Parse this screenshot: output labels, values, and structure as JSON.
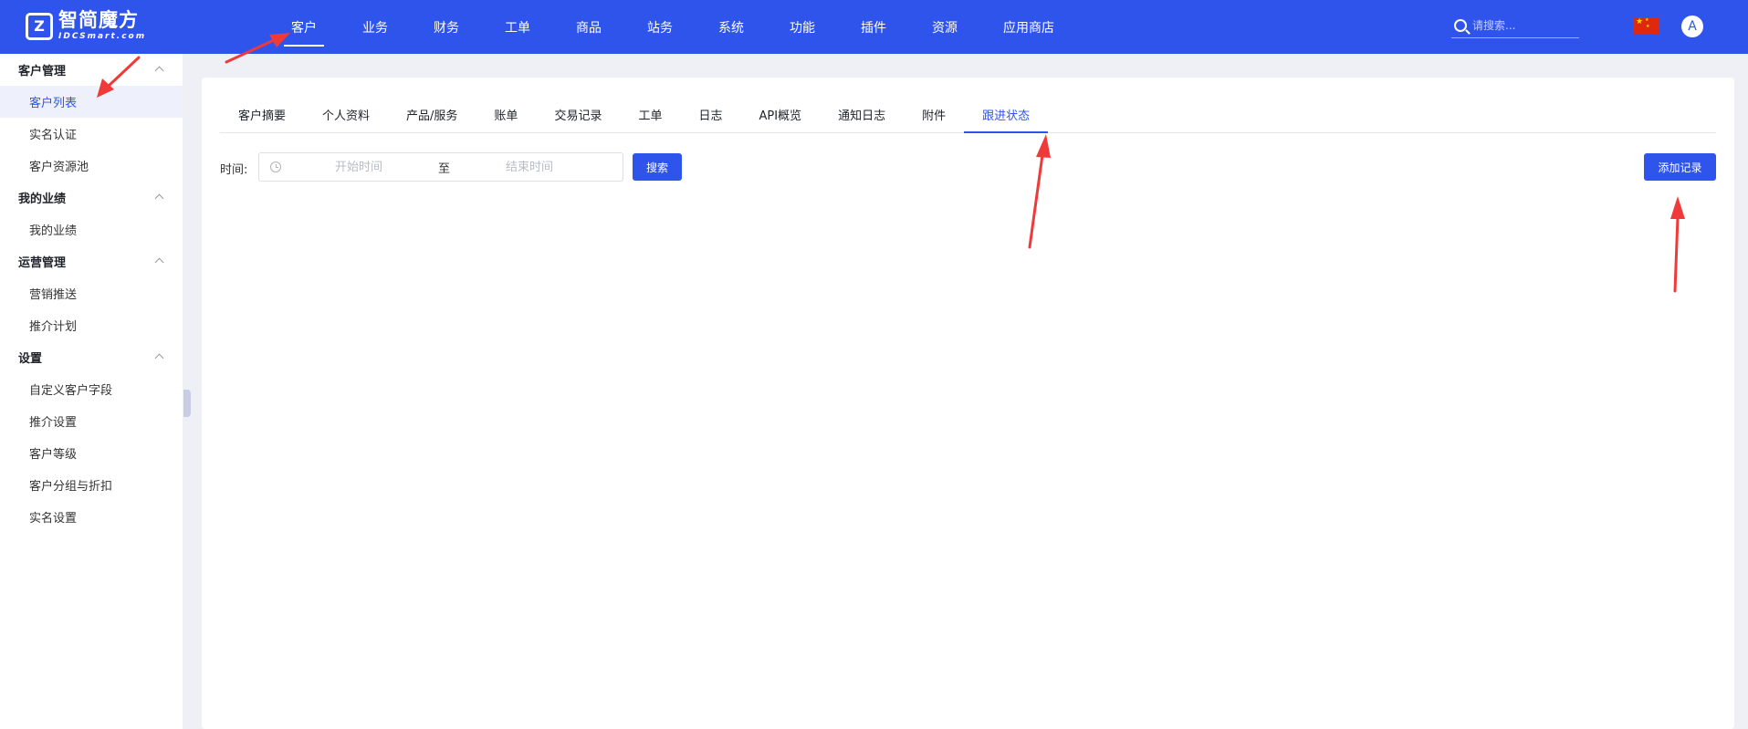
{
  "brand": {
    "logo_mark": "Z",
    "name_cn": "智简魔方",
    "name_en": "IDCSmart.com"
  },
  "topnav": {
    "items": [
      {
        "label": "客户",
        "active": true
      },
      {
        "label": "业务"
      },
      {
        "label": "财务"
      },
      {
        "label": "工单"
      },
      {
        "label": "商品"
      },
      {
        "label": "站务"
      },
      {
        "label": "系统"
      },
      {
        "label": "功能"
      },
      {
        "label": "插件"
      },
      {
        "label": "资源"
      },
      {
        "label": "应用商店"
      }
    ],
    "search_placeholder": "请搜索...",
    "avatar_letter": "A",
    "flag_icon": "china-flag-icon"
  },
  "sidebar": {
    "groups": [
      {
        "title": "客户管理",
        "items": [
          {
            "label": "客户列表",
            "active": true
          },
          {
            "label": "实名认证"
          },
          {
            "label": "客户资源池"
          }
        ]
      },
      {
        "title": "我的业绩",
        "items": [
          {
            "label": "我的业绩"
          }
        ]
      },
      {
        "title": "运营管理",
        "items": [
          {
            "label": "营销推送"
          },
          {
            "label": "推介计划"
          }
        ]
      },
      {
        "title": "设置",
        "items": [
          {
            "label": "自定义客户字段"
          },
          {
            "label": "推介设置"
          },
          {
            "label": "客户等级"
          },
          {
            "label": "客户分组与折扣"
          },
          {
            "label": "实名设置"
          }
        ]
      }
    ]
  },
  "tabs": [
    {
      "label": "客户摘要"
    },
    {
      "label": "个人资料"
    },
    {
      "label": "产品/服务"
    },
    {
      "label": "账单"
    },
    {
      "label": "交易记录"
    },
    {
      "label": "工单"
    },
    {
      "label": "日志"
    },
    {
      "label": "API概览"
    },
    {
      "label": "通知日志"
    },
    {
      "label": "附件"
    },
    {
      "label": "跟进状态",
      "active": true
    }
  ],
  "filter": {
    "label": "时间:",
    "start_placeholder": "开始时间",
    "separator": "至",
    "end_placeholder": "结束时间",
    "search_button": "搜索"
  },
  "actions": {
    "add_record": "添加记录"
  },
  "colors": {
    "primary": "#2f54eb",
    "annotation_arrow": "#f03a3a"
  }
}
